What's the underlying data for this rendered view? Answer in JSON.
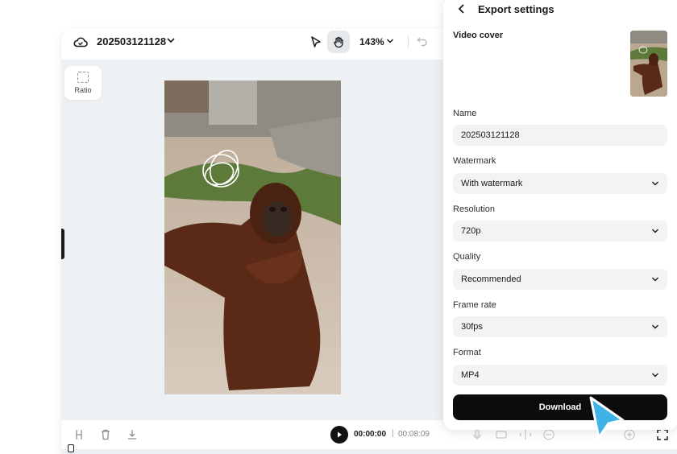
{
  "header": {
    "project_title": "202503121128",
    "zoom": "143%"
  },
  "canvas": {
    "ratio_label": "Ratio"
  },
  "playback": {
    "current_time": "00:00:00",
    "separator": "|",
    "total_time": "00:08:09"
  },
  "export_panel": {
    "title": "Export settings",
    "video_cover_label": "Video cover",
    "name": {
      "label": "Name",
      "value": "202503121128"
    },
    "watermark": {
      "label": "Watermark",
      "value": "With watermark"
    },
    "resolution": {
      "label": "Resolution",
      "value": "720p"
    },
    "quality": {
      "label": "Quality",
      "value": "Recommended"
    },
    "frame_rate": {
      "label": "Frame rate",
      "value": "30fps"
    },
    "format": {
      "label": "Format",
      "value": "MP4"
    },
    "download_label": "Download"
  },
  "colors": {
    "accent_cursor": "#3fb3e6",
    "download_bg": "#0c0c0c",
    "field_bg": "#f1f3f4"
  }
}
